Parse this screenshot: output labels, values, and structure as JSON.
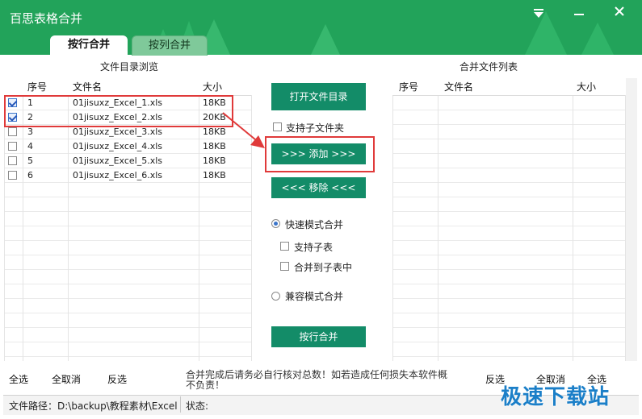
{
  "app": {
    "title": "百思表格合并"
  },
  "tabs": [
    {
      "label": "按行合并"
    },
    {
      "label": "按列合并"
    }
  ],
  "left_panel": {
    "header": "文件目录浏览",
    "columns": [
      "序号",
      "文件名",
      "大小"
    ],
    "rows": [
      {
        "checked": true,
        "index": "1",
        "name": "01jisuxz_Excel_1.xls",
        "size": "18KB"
      },
      {
        "checked": true,
        "index": "2",
        "name": "01jisuxz_Excel_2.xls",
        "size": "20KB"
      },
      {
        "checked": false,
        "index": "3",
        "name": "01jisuxz_Excel_3.xls",
        "size": "18KB"
      },
      {
        "checked": false,
        "index": "4",
        "name": "01jisuxz_Excel_4.xls",
        "size": "18KB"
      },
      {
        "checked": false,
        "index": "5",
        "name": "01jisuxz_Excel_5.xls",
        "size": "18KB"
      },
      {
        "checked": false,
        "index": "6",
        "name": "01jisuxz_Excel_6.xls",
        "size": "18KB"
      }
    ]
  },
  "right_panel": {
    "header": "合并文件列表",
    "columns": [
      "序号",
      "文件名",
      "大小"
    ]
  },
  "middle": {
    "open_dir_button": "打开文件目录",
    "support_subfolder": "支持子文件夹",
    "add_button": ">>> 添加 >>>",
    "remove_button": "<<< 移除 <<<",
    "fast_mode": "快速模式合并",
    "support_subsheet": "支持子表",
    "merge_into_subsheet": "合并到子表中",
    "compat_mode": "兼容模式合并",
    "merge_button": "按行合并"
  },
  "footer": {
    "left_links": [
      "全选",
      "全取消",
      "反选"
    ],
    "right_links": [
      "反选",
      "全取消",
      "全选"
    ],
    "notice": "合并完成后请务必自行核对总数！如若造成任何损失本软件概不负责！",
    "path_label": "文件路径：D:\\backup\\教程素材\\Excel",
    "status_label": "状态:"
  },
  "watermark": "极速下载站",
  "colors": {
    "titlebar": "#22a35a",
    "button": "#138c68",
    "highlight": "#e03a3a"
  }
}
